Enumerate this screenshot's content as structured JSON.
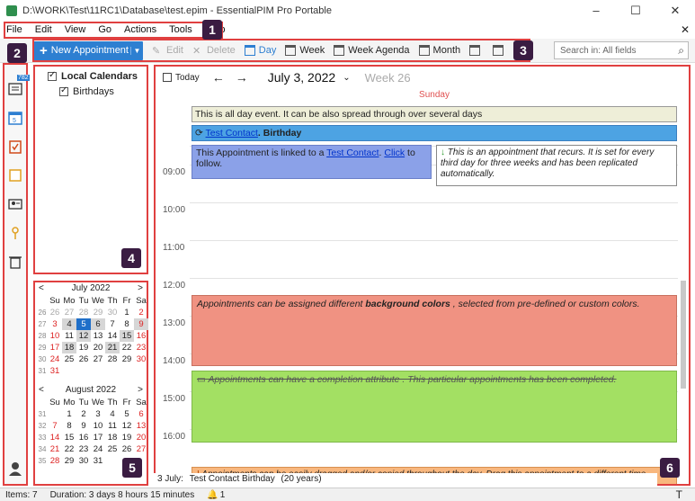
{
  "window": {
    "title": "D:\\WORK\\Test\\11RC1\\Database\\test.epim - EssentialPIM Pro Portable"
  },
  "menu": [
    "File",
    "Edit",
    "View",
    "Go",
    "Actions",
    "Tools",
    "Help"
  ],
  "toolbar": {
    "new_appointment": "New Appointment",
    "edit": "Edit",
    "delete": "Delete",
    "day": "Day",
    "week": "Week",
    "week_agenda": "Week Agenda",
    "month": "Month",
    "search_placeholder": "Search in: All fields"
  },
  "sidebar": {
    "notes_badge": "782"
  },
  "calendars": {
    "root": "Local Calendars",
    "child": "Birthdays"
  },
  "nav": {
    "today": "Today",
    "date": "July 3, 2022",
    "week": "Week 26"
  },
  "day_view": {
    "day_name": "Sunday",
    "all_day": "This is all day event. It can be also spread through over several days",
    "birthday_link": "Test Contact",
    "birthday_rest": ". Birthday",
    "hours": [
      "09:00",
      "10:00",
      "11:00",
      "12:00",
      "13:00",
      "14:00",
      "15:00",
      "16:00"
    ],
    "appt_linked_pre": "This Appointment is linked to a ",
    "appt_linked_link": "Test Contact",
    "appt_linked_mid": ". ",
    "appt_linked_click": "Click",
    "appt_linked_post": " to follow.",
    "appt_recur": "This is an appointment that recurs. It is set for every third day for three weeks and has been replicated automatically.",
    "appt_color_pre": "Appointments can be assigned different ",
    "appt_color_bold": "background colors",
    "appt_color_post": " , selected from pre-defined or custom colors.",
    "appt_completed": "Appointments can have a completion attribute . This particular appointments has been completed.",
    "appt_drag": "Appointments can be easily dragged and/or copied throughout the day. Drag this appointment to a different time"
  },
  "birthday_strip": {
    "date": "3 July:",
    "text": "Test Contact Birthday",
    "age": "(20 years)"
  },
  "minical": {
    "dow": [
      "Su",
      "Mo",
      "Tu",
      "We",
      "Th",
      "Fr",
      "Sa"
    ],
    "july": {
      "title": "July  2022",
      "weeks": [
        {
          "wk": "26",
          "days": [
            "26",
            "27",
            "28",
            "29",
            "30",
            "1",
            "2"
          ]
        },
        {
          "wk": "27",
          "days": [
            "3",
            "4",
            "5",
            "6",
            "7",
            "8",
            "9"
          ]
        },
        {
          "wk": "28",
          "days": [
            "10",
            "11",
            "12",
            "13",
            "14",
            "15",
            "16"
          ]
        },
        {
          "wk": "29",
          "days": [
            "17",
            "18",
            "19",
            "20",
            "21",
            "22",
            "23"
          ]
        },
        {
          "wk": "30",
          "days": [
            "24",
            "25",
            "26",
            "27",
            "28",
            "29",
            "30"
          ]
        },
        {
          "wk": "31",
          "days": [
            "31",
            "",
            "",
            "",
            "",
            "",
            ""
          ]
        }
      ]
    },
    "august": {
      "title": "August  2022",
      "weeks": [
        {
          "wk": "31",
          "days": [
            "",
            "1",
            "2",
            "3",
            "4",
            "5",
            "6"
          ]
        },
        {
          "wk": "32",
          "days": [
            "7",
            "8",
            "9",
            "10",
            "11",
            "12",
            "13"
          ]
        },
        {
          "wk": "33",
          "days": [
            "14",
            "15",
            "16",
            "17",
            "18",
            "19",
            "20"
          ]
        },
        {
          "wk": "34",
          "days": [
            "21",
            "22",
            "23",
            "24",
            "25",
            "26",
            "27"
          ]
        },
        {
          "wk": "35",
          "days": [
            "28",
            "29",
            "30",
            "31",
            "",
            "",
            ""
          ]
        }
      ]
    }
  },
  "status": {
    "items": "Items: 7",
    "duration": "Duration: 3 days 8 hours 15 minutes",
    "reminders": "1"
  },
  "callouts": [
    "1",
    "2",
    "3",
    "4",
    "5",
    "6"
  ]
}
